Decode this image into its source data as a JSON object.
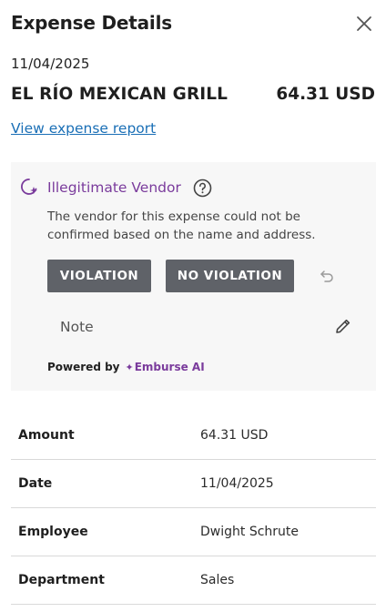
{
  "header": {
    "title": "Expense Details"
  },
  "expense": {
    "date": "11/04/2025",
    "vendor": "EL RÍO MEXICAN GRILL",
    "amount": "64.31 USD",
    "report_link": "View expense report"
  },
  "alert": {
    "title": "Illegitimate Vendor",
    "description": "The vendor for this expense could not be confirmed based on the name and address.",
    "violation_label": "VIOLATION",
    "no_violation_label": "NO VIOLATION",
    "note_label": "Note",
    "powered_by": "Powered by",
    "brand": "Emburse AI",
    "accent_color": "#7a3b9c"
  },
  "details": [
    {
      "label": "Amount",
      "value": "64.31 USD"
    },
    {
      "label": "Date",
      "value": "11/04/2025"
    },
    {
      "label": "Employee",
      "value": "Dwight Schrute"
    },
    {
      "label": "Department",
      "value": "Sales"
    }
  ],
  "icons": {
    "close": "close-icon",
    "alert": "ai-sparkle-alert-icon",
    "help": "question-circle-icon",
    "undo": "undo-icon",
    "edit": "pencil-icon"
  }
}
